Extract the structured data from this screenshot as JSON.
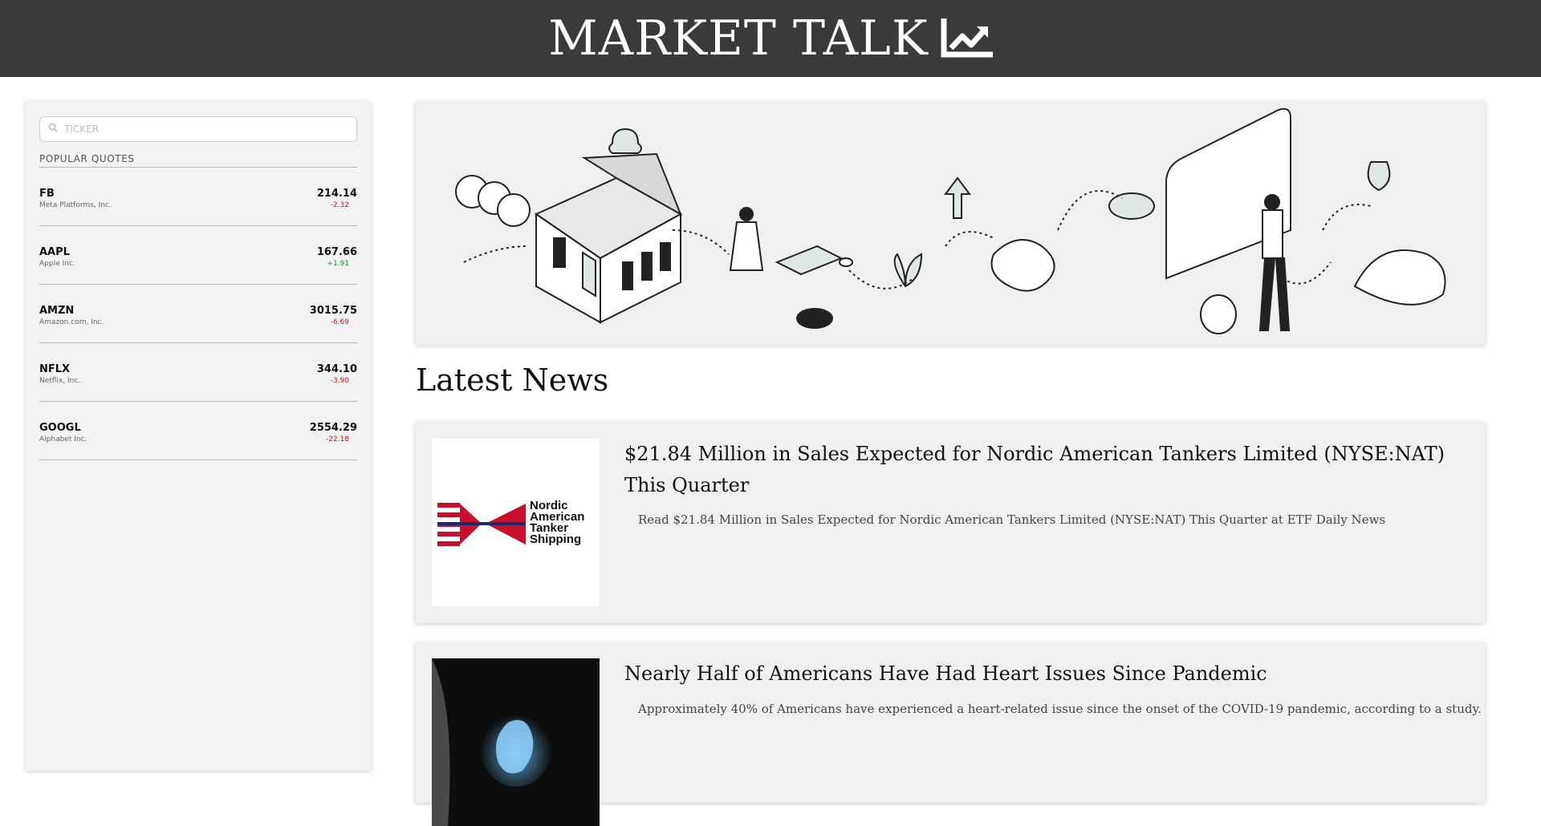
{
  "header": {
    "title": "MARKET TALK",
    "icon": "chart-line-icon"
  },
  "search": {
    "placeholder": "TICKER"
  },
  "popular": {
    "title": "POPULAR QUOTES",
    "quotes": [
      {
        "symbol": "FB",
        "name": "Meta Platforms, Inc.",
        "price": "214.14",
        "change": "-2.32"
      },
      {
        "symbol": "AAPL",
        "name": "Apple Inc.",
        "price": "167.66",
        "change": "+1.91"
      },
      {
        "symbol": "AMZN",
        "name": "Amazon.com, Inc.",
        "price": "3015.75",
        "change": "-6.69"
      },
      {
        "symbol": "NFLX",
        "name": "Netflix, Inc.",
        "price": "344.10",
        "change": "-3.90"
      },
      {
        "symbol": "GOOGL",
        "name": "Alphabet Inc.",
        "price": "2554.29",
        "change": "-22.18"
      }
    ]
  },
  "colors": {
    "negative": "#d0101b",
    "positive": "#1b8a2a",
    "header_bg": "#3a3a3a"
  },
  "hero": {
    "image": "market-illustration"
  },
  "news": {
    "heading": "Latest News",
    "articles": [
      {
        "title": "$21.84 Million in Sales Expected for Nordic American Tankers Limited (NYSE:NAT) This Quarter",
        "description": "Read $21.84 Million in Sales Expected for Nordic American Tankers Limited (NYSE:NAT) This Quarter at ETF Daily News",
        "thumb_text": [
          "Nordic",
          "American",
          "Tanker",
          "Shipping"
        ]
      },
      {
        "title": "Nearly Half of Americans Have Had Heart Issues Since Pandemic",
        "description": "Approximately 40% of Americans have experienced a heart-related issue since the onset of the COVID-19 pandemic, according to a study."
      }
    ]
  }
}
